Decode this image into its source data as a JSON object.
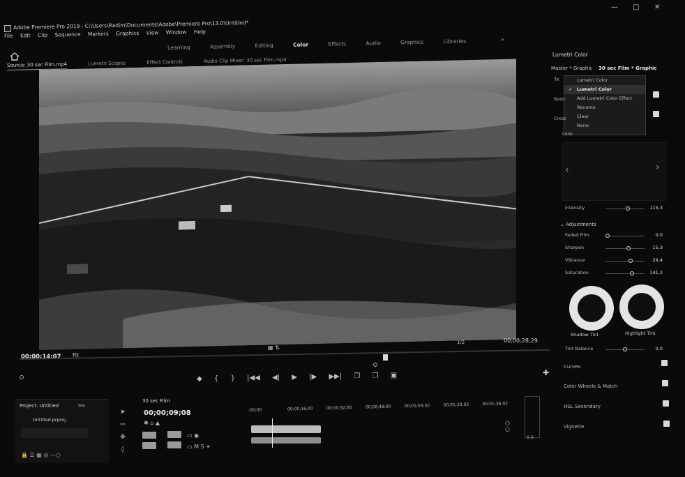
{
  "window": {
    "title": "Adobe Premiere Pro 2019 - C:\\Users\\Radim\\Documents\\Adobe\\Premiere Pro\\13.0\\Untitled*",
    "minimize": "—",
    "maximize": "□",
    "close": "✕"
  },
  "menu": [
    "File",
    "Edit",
    "Clip",
    "Sequence",
    "Markers",
    "Graphics",
    "View",
    "Window",
    "Help"
  ],
  "workspaces": {
    "tabs": [
      "Learning",
      "Assembly",
      "Editing",
      "Color",
      "Effects",
      "Audio",
      "Graphics",
      "Libraries"
    ],
    "active": "Color",
    "more": "»"
  },
  "source_panel": {
    "tabs": [
      "Source: 30 sec Film.mp4",
      "Lumetri Scopes",
      "Effect Controls",
      "Audio Clip Mixer: 30 sec Film.mp4"
    ]
  },
  "monitor": {
    "timecode_left": "00;00;14;07",
    "fit": "Fit",
    "fraction": "1/2",
    "timecode_right": "00;00;28;29"
  },
  "transport": [
    "◆",
    "{",
    "}",
    "|◀◀",
    "◀|",
    "▶",
    "|▶",
    "▶▶|",
    "❐",
    "❒",
    "▣"
  ],
  "project": {
    "tab": "Project: Untitled",
    "tab2": "Me",
    "file": "Untitled.prproj"
  },
  "timeline": {
    "tab": "30 sec Film",
    "timecode": "00;00;09;08",
    "ruler": [
      ";00;00",
      "00;00;16;00",
      "00;00;32;00",
      "00;00;48;00",
      "00;01;04;02",
      "00;01;20;02",
      "00;01;36;02"
    ],
    "meter_labels": "S  S"
  },
  "lumetri": {
    "title": "Lumetri Color",
    "master": "Master * Graphic",
    "clip": "30 sec Film * Graphic",
    "fx": "fx",
    "dropdown": [
      "Lumetri Color",
      "Add Lumetri Color Effect",
      "Rename",
      "Clear",
      "None"
    ],
    "dropdown_selected": "Lumetri Color",
    "basic_label": "Basic",
    "creative_label": "Creat",
    "look_label": "Look",
    "intensity": {
      "label": "Intensity",
      "value": "115,3",
      "level": 0.58
    },
    "adjustments_label": "Adjustments",
    "sliders": [
      {
        "label": "Faded Film",
        "value": "0,0",
        "level": 0.0
      },
      {
        "label": "Sharpen",
        "value": "15,3",
        "level": 0.6
      },
      {
        "label": "Vibrance",
        "value": "29,4",
        "level": 0.65
      },
      {
        "label": "Saturation",
        "value": "141,2",
        "level": 0.7
      }
    ],
    "wheels": [
      "Shadow Tint",
      "Highlight Tint"
    ],
    "tint_balance": {
      "label": "Tint Balance",
      "value": "0,0",
      "level": 0.5
    },
    "sections": [
      "Curves",
      "Color Wheels & Match",
      "HSL Secondary",
      "Vignette"
    ]
  }
}
